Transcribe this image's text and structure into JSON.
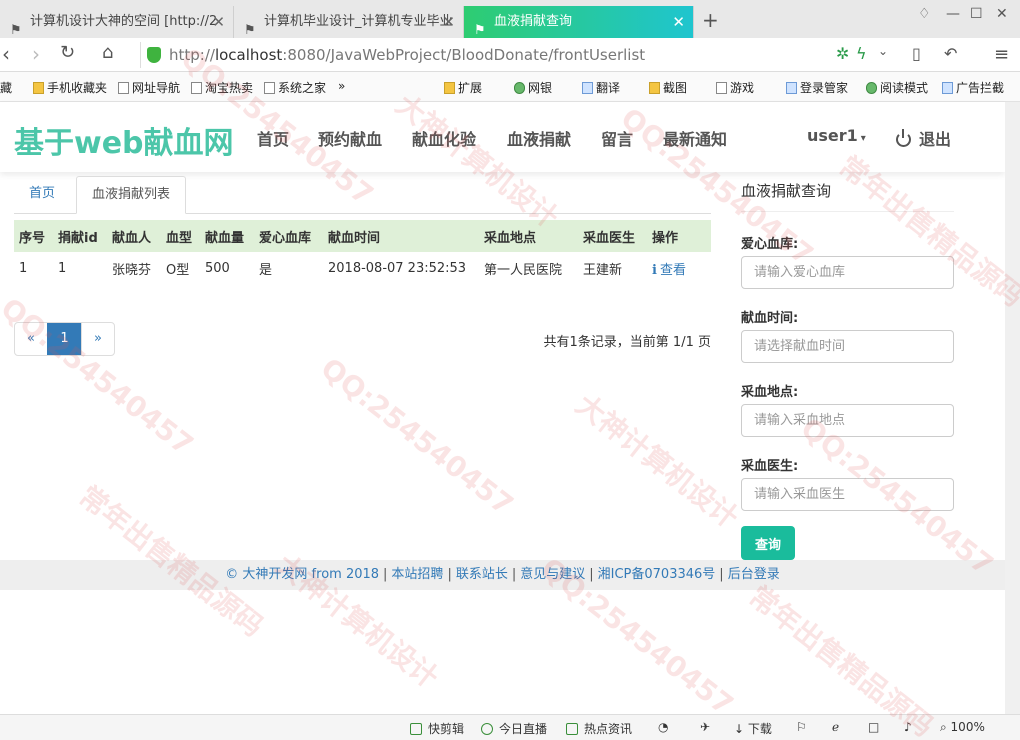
{
  "browser": {
    "tabs": [
      {
        "title": "计算机设计大神的空间 [http://2"
      },
      {
        "title": "计算机毕业设计_计算机专业毕业"
      },
      {
        "title": "血液捐献查询"
      }
    ],
    "url": {
      "scheme": "http://",
      "host": "localhost",
      "path": ":8080/JavaWebProject/BloodDonate/frontUserlist"
    },
    "bookmarks": [
      "藏",
      "手机收藏夹",
      "网址导航",
      "淘宝热卖",
      "系统之家",
      "»",
      "扩展",
      "网银",
      "翻译",
      "截图",
      "游戏",
      "登录管家",
      "阅读模式",
      "广告拦截"
    ]
  },
  "site": {
    "logo": "基于web献血网",
    "nav": [
      "首页",
      "预约献血",
      "献血化验",
      "血液捐献",
      "留言",
      "最新通知"
    ],
    "user": "user1",
    "logout": "退出"
  },
  "page_tabs": {
    "home": "首页",
    "list": "血液捐献列表"
  },
  "table": {
    "headers": [
      "序号",
      "捐献id",
      "献血人",
      "血型",
      "献血量",
      "爱心血库",
      "献血时间",
      "采血地点",
      "采血医生",
      "操作"
    ],
    "rows": [
      [
        "1",
        "1",
        "张晓芬",
        "O型",
        "500",
        "是",
        "2018-08-07 23:52:53",
        "第一人民医院",
        "王建新",
        "查看"
      ]
    ]
  },
  "pager": {
    "prev": "«",
    "current": "1",
    "next": "»",
    "summary": "共有1条记录，当前第 1/1 页"
  },
  "search": {
    "title": "血液捐献查询",
    "fields": [
      {
        "label": "爱心血库:",
        "placeholder": "请输入爱心血库"
      },
      {
        "label": "献血时间:",
        "placeholder": "请选择献血时间"
      },
      {
        "label": "采血地点:",
        "placeholder": "请输入采血地点"
      },
      {
        "label": "采血医生:",
        "placeholder": "请输入采血医生"
      }
    ],
    "button": "查询"
  },
  "footer": {
    "links": [
      "© 大神开发网 from 2018",
      "本站招聘",
      "联系站长",
      "意见与建议",
      "湘ICP备0703346号",
      "后台登录"
    ]
  },
  "statusbar": {
    "items": [
      "快剪辑",
      "今日直播",
      "热点资讯",
      "下载",
      "100%"
    ]
  },
  "watermark": [
    "QQ:254540457",
    "大神计算机设计",
    "常年出售精品源码"
  ],
  "colors": {
    "accent": "#4cc6a9",
    "button": "#1abc9c",
    "link": "#337ab7",
    "table_head": "#dff0d8"
  }
}
